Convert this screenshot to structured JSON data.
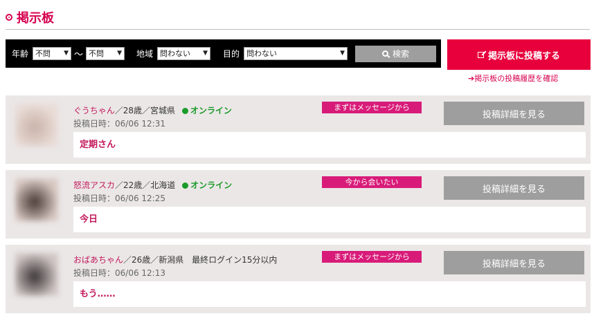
{
  "header": {
    "title": "掲示板"
  },
  "search": {
    "age_label": "年齢",
    "age_from": "不問",
    "tilde": "〜",
    "age_to": "不問",
    "region_label": "地域",
    "region_value": "問わない",
    "purpose_label": "目的",
    "purpose_value": "問わない",
    "search_button": "検索",
    "arrow_glyph": "▼"
  },
  "post_button": {
    "label": "掲示板に投稿する"
  },
  "history_link": {
    "label": "➔掲示板の投稿履歴を確認"
  },
  "posts": [
    {
      "name": "ぐうちゃん",
      "meta": "／28歳／宮城県",
      "online": "オンライン",
      "date": "投稿日時：06/06 12:31",
      "tag": "まずはメッセージから",
      "detail_button": "投稿詳細を見る",
      "message": "定期さん",
      "avatar_colors": [
        "#e9dcd7",
        "#c9b2a8"
      ]
    },
    {
      "name": "怒流アスカ",
      "meta": "／22歳／北海道",
      "online": "オンライン",
      "date": "投稿日時：06/06 12:25",
      "tag": "今から会いたい",
      "detail_button": "投稿詳細を見る",
      "message": "今日",
      "avatar_colors": [
        "#d8c8c2",
        "#4a3a36"
      ]
    },
    {
      "name": "おばあちゃん",
      "meta": "／26歳／新潟県",
      "last_login": "最終ログイン15分以内",
      "date": "投稿日時：06/06 12:13",
      "tag": "まずはメッセージから",
      "detail_button": "投稿詳細を見る",
      "message": "もう……",
      "avatar_colors": [
        "#cfc6c4",
        "#3b3535"
      ]
    }
  ]
}
